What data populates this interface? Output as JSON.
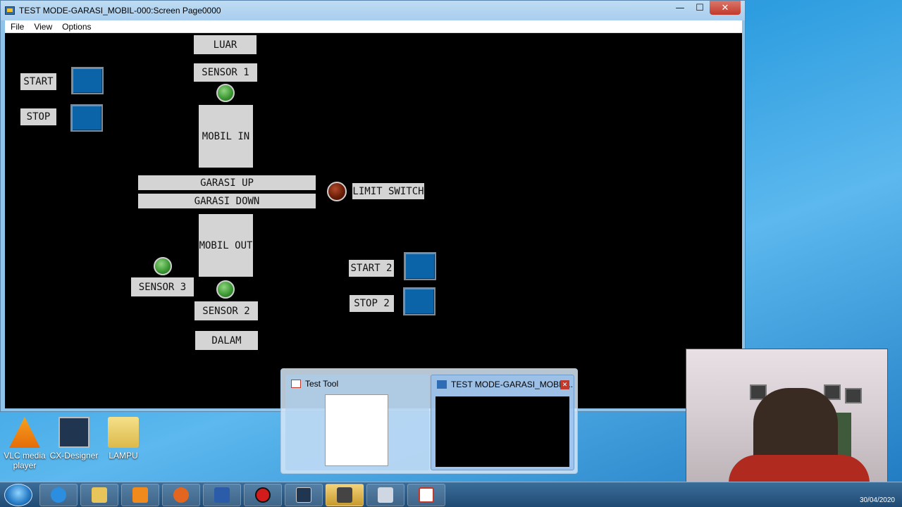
{
  "window": {
    "title": "TEST MODE-GARASI_MOBIL-000:Screen Page0000",
    "controls": {
      "minimize": "—",
      "maximize": "☐",
      "close": "✕"
    },
    "menu": [
      "File",
      "View",
      "Options"
    ]
  },
  "hmi": {
    "luar": "LUAR",
    "sensor1": "SENSOR 1",
    "mobil_in": "MOBIL IN",
    "garasi_up": "GARASI UP",
    "garasi_down": "GARASI DOWN",
    "limit_switch": "LIMIT SWITCH",
    "mobil_out": "MOBIL OUT",
    "sensor3": "SENSOR 3",
    "sensor2": "SENSOR 2",
    "dalam": "DALAM",
    "start": "START",
    "stop": "STOP",
    "start2": "START 2",
    "stop2": "STOP 2",
    "colors": {
      "button": "#0b63a8",
      "lamp_on": "#3e9a36",
      "lamp_limit": "#6a1e08",
      "label_bg": "#d4d4d4"
    }
  },
  "desktop_icons": [
    {
      "label": "VLC media player",
      "icon": "vlc-icon"
    },
    {
      "label": "CX-Designer",
      "icon": "cx-designer-icon"
    },
    {
      "label": "LAMPU",
      "icon": "folder-icon"
    }
  ],
  "thumbnails": [
    {
      "title": "Test Tool"
    },
    {
      "title": "TEST MODE-GARASI_MOBIL..."
    }
  ],
  "taskbar": {
    "items": [
      "start-orb-icon",
      "internet-explorer-icon",
      "file-explorer-icon",
      "media-player-icon",
      "firefox-icon",
      "word-icon",
      "record-icon",
      "cx-designer-icon",
      "cx-programmer-icon",
      "network-icon",
      "test-tool-icon"
    ],
    "date": "30/04/2020"
  }
}
